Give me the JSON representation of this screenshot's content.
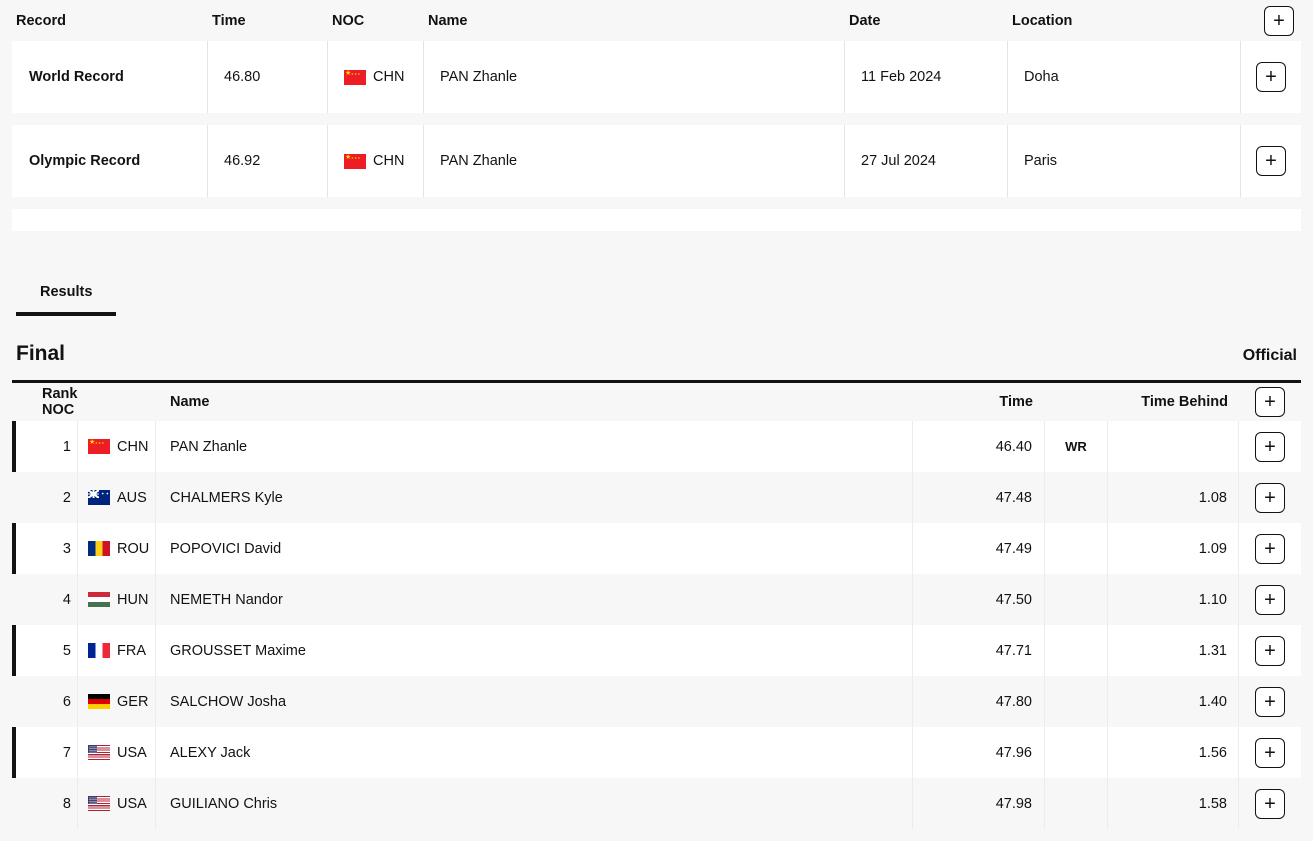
{
  "records_table": {
    "columns": [
      "Record",
      "Time",
      "NOC",
      "Name",
      "Date",
      "Location"
    ],
    "add_label": "+",
    "rows": [
      {
        "record": "World Record",
        "time": "46.80",
        "noc": "CHN",
        "flag": "flag-chn",
        "name": "PAN Zhanle",
        "date": "11 Feb 2024",
        "location": "Doha"
      },
      {
        "record": "Olympic Record",
        "time": "46.92",
        "noc": "CHN",
        "flag": "flag-chn",
        "name": "PAN Zhanle",
        "date": "27 Jul 2024",
        "location": "Paris"
      }
    ]
  },
  "tabs": [
    {
      "label": "Results",
      "active": true
    }
  ],
  "final": {
    "title": "Final",
    "status": "Official"
  },
  "results_table": {
    "columns": {
      "rank_noc": "Rank NOC",
      "name": "Name",
      "time": "Time",
      "time_behind": "Time Behind"
    },
    "add_label": "+",
    "rows": [
      {
        "rank": "1",
        "noc": "CHN",
        "flag": "flag-chn",
        "name": "PAN Zhanle",
        "time": "46.40",
        "mark": "WR",
        "behind": ""
      },
      {
        "rank": "2",
        "noc": "AUS",
        "flag": "flag-aus",
        "name": "CHALMERS Kyle",
        "time": "47.48",
        "mark": "",
        "behind": "1.08"
      },
      {
        "rank": "3",
        "noc": "ROU",
        "flag": "flag-rou",
        "name": "POPOVICI David",
        "time": "47.49",
        "mark": "",
        "behind": "1.09"
      },
      {
        "rank": "4",
        "noc": "HUN",
        "flag": "flag-hun",
        "name": "NEMETH Nandor",
        "time": "47.50",
        "mark": "",
        "behind": "1.10"
      },
      {
        "rank": "5",
        "noc": "FRA",
        "flag": "flag-fra",
        "name": "GROUSSET Maxime",
        "time": "47.71",
        "mark": "",
        "behind": "1.31"
      },
      {
        "rank": "6",
        "noc": "GER",
        "flag": "flag-ger",
        "name": "SALCHOW Josha",
        "time": "47.80",
        "mark": "",
        "behind": "1.40"
      },
      {
        "rank": "7",
        "noc": "USA",
        "flag": "flag-usa",
        "name": "ALEXY Jack",
        "time": "47.96",
        "mark": "",
        "behind": "1.56"
      },
      {
        "rank": "8",
        "noc": "USA",
        "flag": "flag-usa",
        "name": "GUILIANO Chris",
        "time": "47.98",
        "mark": "",
        "behind": "1.58"
      }
    ]
  },
  "colors": {
    "page_background": "#f7f7f7",
    "card_background": "#ffffff",
    "text": "#121212",
    "accent": "#121212",
    "divider": "#ececec"
  }
}
